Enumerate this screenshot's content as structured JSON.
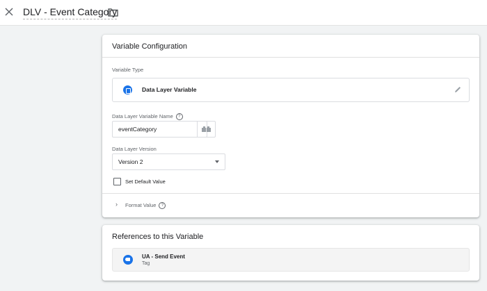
{
  "header": {
    "title": "DLV - Event Category",
    "close_icon": "close-icon",
    "folder_icon": "folder-icon"
  },
  "config": {
    "card_title": "Variable Configuration",
    "variable_type_label": "Variable Type",
    "variable_type_value": "Data Layer Variable",
    "name_label": "Data Layer Variable Name",
    "name_value": "eventCategory",
    "version_label": "Data Layer Version",
    "version_value": "Version 2",
    "default_value_label": "Set Default Value",
    "format_value_label": "Format Value",
    "help_glyph": "?",
    "chevron_glyph": "›"
  },
  "references": {
    "card_title": "References to this Variable",
    "items": [
      {
        "name": "UA - Send Event",
        "type": "Tag"
      }
    ]
  },
  "colors": {
    "accent": "#1a73e8",
    "background": "#f1f3f4"
  }
}
